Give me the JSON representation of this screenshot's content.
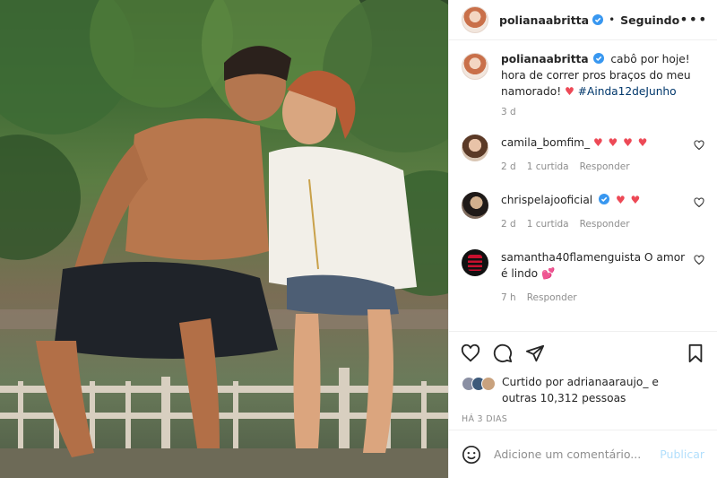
{
  "header": {
    "username": "polianaabritta",
    "separator": "•",
    "follow_status": "Seguindo",
    "more_icon": "more-horizontal-icon"
  },
  "caption": {
    "username": "polianaabritta",
    "text": "cabô por hoje! hora de correr pros braços do meu namorado!",
    "emoji": "♥",
    "hashtag": "#Ainda12deJunho",
    "time": "3 d"
  },
  "comments": [
    {
      "username": "camila_bomfim_",
      "text": "",
      "hearts": "♥ ♥ ♥ ♥",
      "time": "2 d",
      "likes": "1 curtida",
      "reply_label": "Responder"
    },
    {
      "username": "chrispelajooficial",
      "text": "",
      "hearts": "♥ ♥",
      "time": "2 d",
      "likes": "1 curtida",
      "reply_label": "Responder"
    },
    {
      "username": "samantha40flamenguista",
      "text": "O amor é lindo",
      "hearts": "💕",
      "time": "7 h",
      "likes": "",
      "reply_label": "Responder"
    }
  ],
  "likes": {
    "prefix": "Curtido por",
    "user": "adrianaaraujo_",
    "middle": "e",
    "rest": "outras 10,312 pessoas"
  },
  "posted_ago": "HÁ 3 DIAS",
  "add_comment": {
    "placeholder": "Adicione um comentário...",
    "publish_label": "Publicar"
  },
  "colors": {
    "verified": "#3897f0",
    "heart": "#ed4956",
    "hashtag": "#00376b",
    "publish_disabled": "#b2dffc"
  }
}
